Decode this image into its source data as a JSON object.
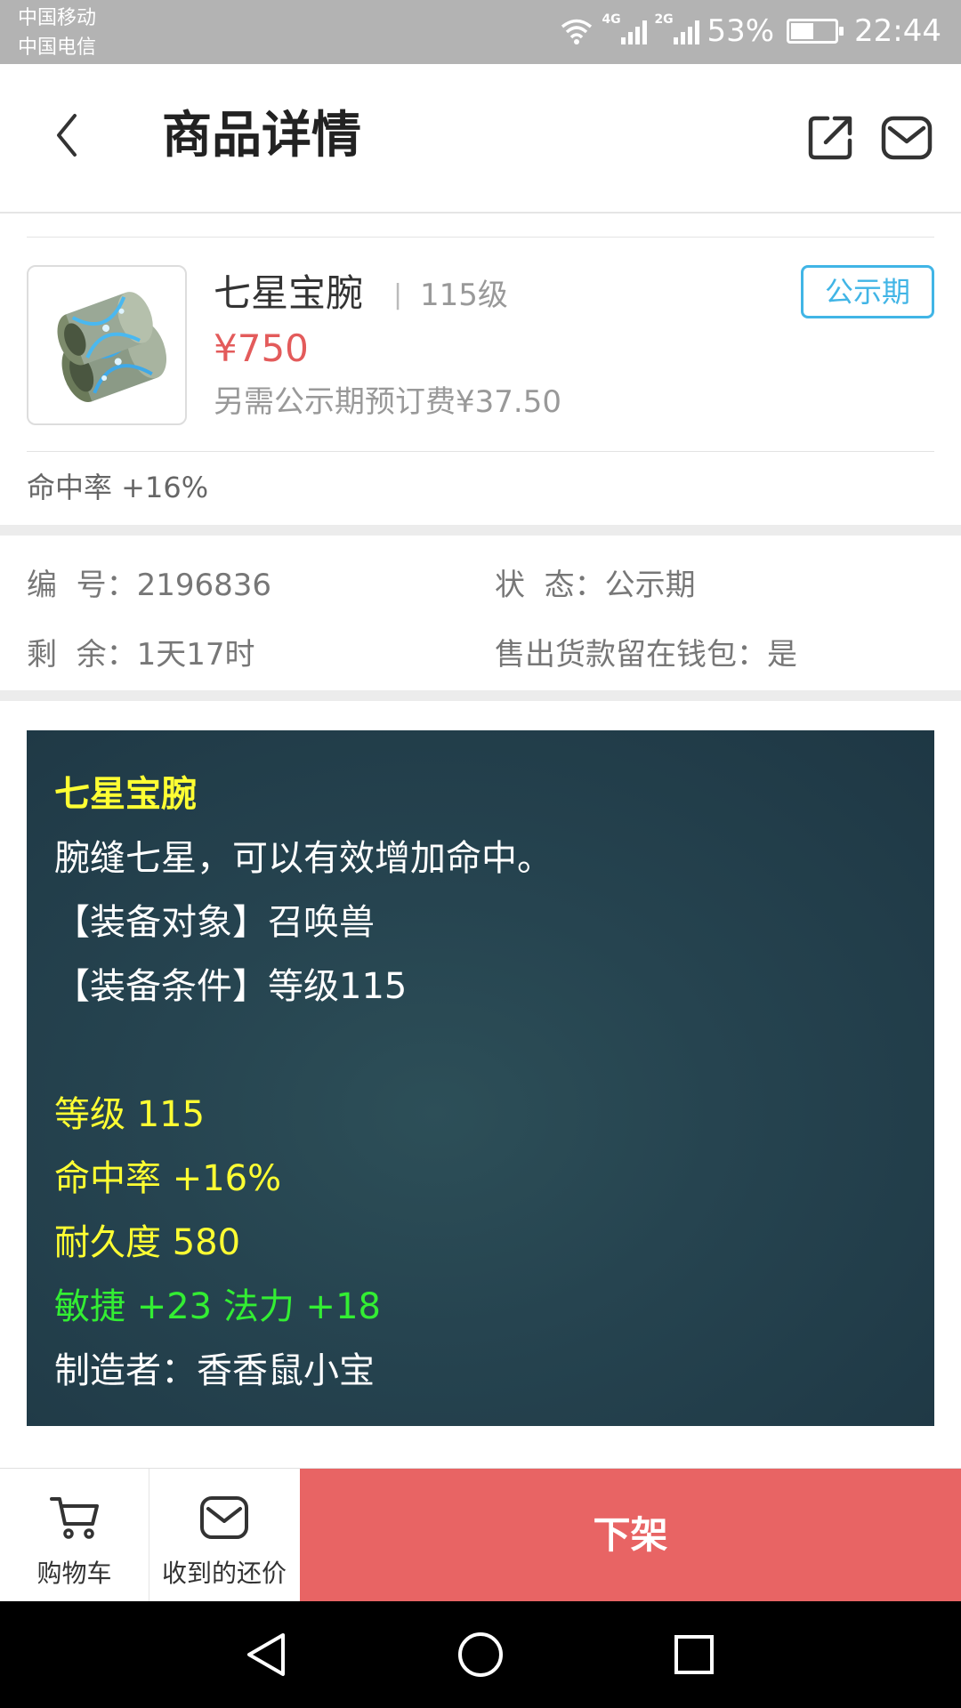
{
  "status_bar": {
    "carrier1": "中国移动",
    "carrier2": "中国电信",
    "net1": "4G",
    "net2": "2G",
    "battery": "53%",
    "battery_level": 0.53,
    "time": "22:44"
  },
  "header": {
    "title": "商品详情",
    "icons": [
      "back-icon",
      "share-icon",
      "mail-icon"
    ]
  },
  "product": {
    "name": "七星宝腕",
    "separator": "|",
    "level": "115级",
    "price": "¥750",
    "fee_note": "另需公示期预订费¥37.50",
    "status_tag": "公示期",
    "attribute_summary": "命中率 +16%"
  },
  "info": {
    "id_label": "编  号：",
    "id_value": "2196836",
    "state_label": "状  态：",
    "state_value": "公示期",
    "remaining_label": "剩  余：",
    "remaining_value": "1天17时",
    "wallet_label": "售出货款留在钱包：",
    "wallet_value": "是"
  },
  "description": {
    "title": "七星宝腕",
    "lines": [
      "腕缝七星，可以有效增加命中。",
      "【装备对象】召唤兽",
      "【装备条件】等级115",
      "",
      "等级 115",
      "命中率 +16%",
      "耐久度 580",
      "敏捷 +23 法力 +18",
      "制造者：香香鼠小宝"
    ]
  },
  "bottom_bar": {
    "cart_label": "购物车",
    "offers_label": "收到的还价",
    "delist_label": "下架"
  },
  "colors": {
    "accent_red": "#e86464",
    "price_red": "#e35b5b",
    "tag_blue": "#41b5e6",
    "desc_yellow": "#ffff33",
    "desc_green": "#33ee33"
  }
}
